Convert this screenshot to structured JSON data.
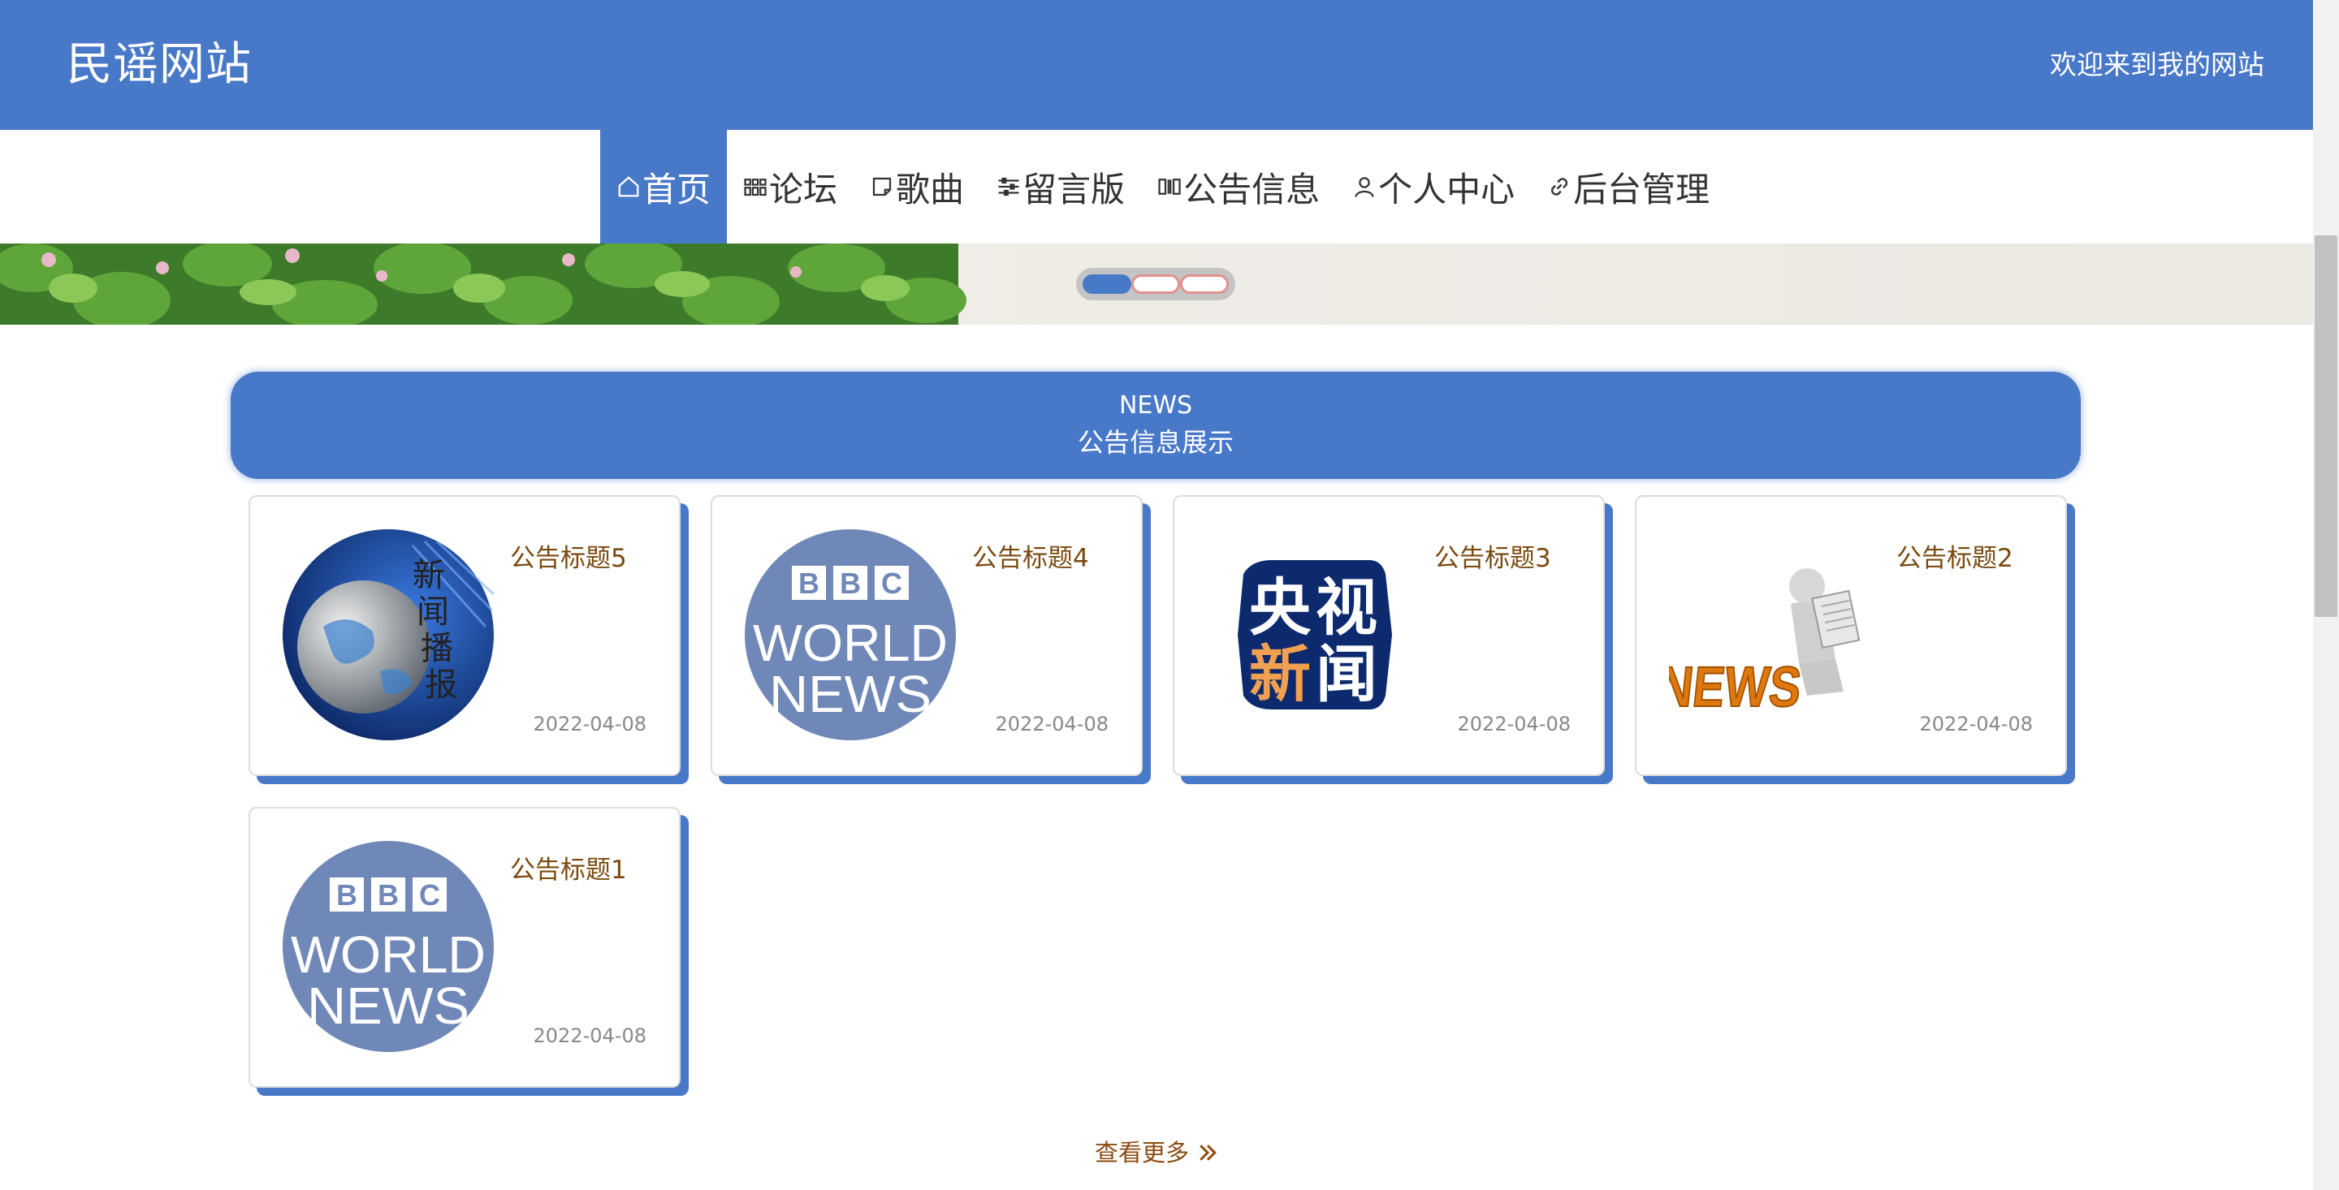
{
  "header": {
    "site_title": "民谣网站",
    "welcome": "欢迎来到我的网站"
  },
  "nav": {
    "items": [
      {
        "label": "首页",
        "icon": "home-icon",
        "active": true
      },
      {
        "label": "论坛",
        "icon": "grid-icon"
      },
      {
        "label": "歌曲",
        "icon": "note-icon"
      },
      {
        "label": "留言版",
        "icon": "sliders-icon"
      },
      {
        "label": "公告信息",
        "icon": "columns-icon"
      },
      {
        "label": "个人中心",
        "icon": "user-icon"
      },
      {
        "label": "后台管理",
        "icon": "link-icon"
      }
    ]
  },
  "carousel": {
    "slides": 3,
    "active_slide": 1
  },
  "section": {
    "title_en": "NEWS",
    "title_cn": "公告信息展示"
  },
  "cards": [
    {
      "title": "公告标题5",
      "date": "2022-04-08",
      "image": "globe-news-image",
      "image_text": "新闻播报"
    },
    {
      "title": "公告标题4",
      "date": "2022-04-08",
      "image": "bbc-world-news-logo",
      "image_text": [
        "BBC",
        "WORLD",
        "NEWS"
      ]
    },
    {
      "title": "公告标题3",
      "date": "2022-04-08",
      "image": "cctv-news-logo",
      "image_text": [
        "央视",
        "新闻"
      ]
    },
    {
      "title": "公告标题2",
      "date": "2022-04-08",
      "image": "news-3d-figure-image",
      "image_text": "NEWS"
    },
    {
      "title": "公告标题1",
      "date": "2022-04-08",
      "image": "bbc-world-news-logo",
      "image_text": [
        "BBC",
        "WORLD",
        "NEWS"
      ]
    }
  ],
  "more": {
    "label": "查看更多",
    "icon": "double-chevron-right-icon"
  },
  "colors": {
    "primary": "#4878c8",
    "title_brown": "#7a4a10",
    "bbc_blue": "#7088b8",
    "cctv_navy": "#0d2a6e",
    "cctv_orange": "#f0a050"
  }
}
